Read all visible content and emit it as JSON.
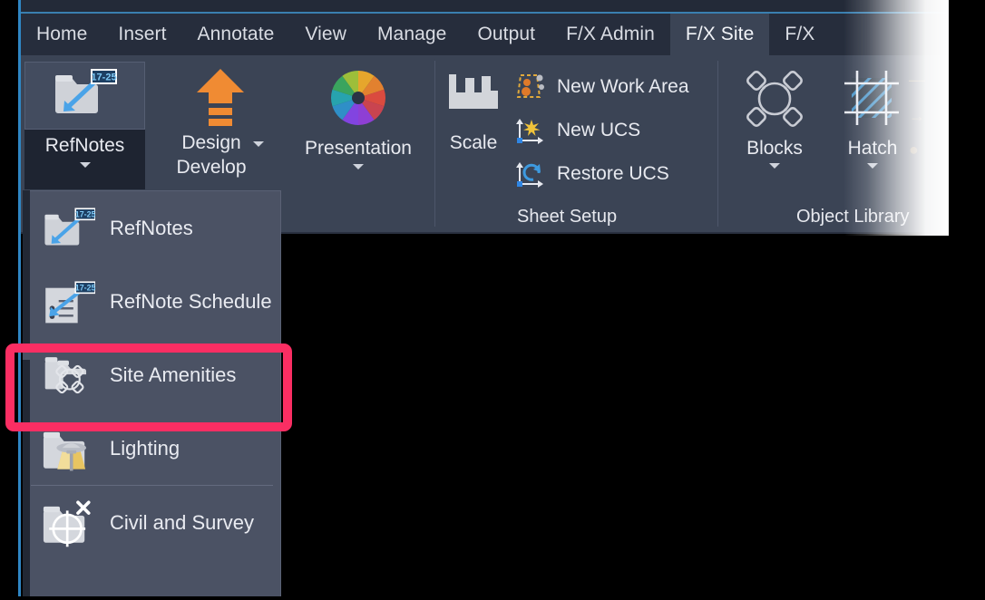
{
  "app": {
    "theme_bg": "#3b4455",
    "tabbar_bg": "#262d3c",
    "menu_bg": "#4b5264",
    "accent_blue": "#2f86c4",
    "highlight_color": "#fa2e63",
    "text_color": "#e8eaf0"
  },
  "ribbon_tabs": [
    {
      "label": "Home",
      "active": false
    },
    {
      "label": "Insert",
      "active": false
    },
    {
      "label": "Annotate",
      "active": false
    },
    {
      "label": "View",
      "active": false
    },
    {
      "label": "Manage",
      "active": false
    },
    {
      "label": "Output",
      "active": false
    },
    {
      "label": "F/X Admin",
      "active": false
    },
    {
      "label": "F/X Site",
      "active": true
    },
    {
      "label": "F/X",
      "active": false
    }
  ],
  "panels": {
    "refnotes": {
      "button_label": "RefNotes",
      "icon": "refnotes-folder-icon",
      "badge": "17-25",
      "has_dropdown": true,
      "state": "active"
    },
    "design_develop": {
      "button_label_line1": "Design",
      "button_label_line2": "Develop",
      "icon": "orange-up-arrow-icon",
      "has_dropdown": true
    },
    "presentation": {
      "button_label": "Presentation",
      "icon": "color-wheel-icon",
      "has_dropdown": true
    },
    "scale": {
      "button_label": "Scale",
      "icon": "scale-bars-icon",
      "has_dropdown": false
    },
    "sheet_setup": {
      "title": "Sheet Setup",
      "items": [
        {
          "label": "New Work Area",
          "icon": "work-area-icon"
        },
        {
          "label": "New UCS",
          "icon": "new-ucs-icon"
        },
        {
          "label": "Restore UCS",
          "icon": "restore-ucs-icon"
        }
      ]
    },
    "object_library": {
      "title": "Object Library",
      "items": [
        {
          "label": "Blocks",
          "icon": "blocks-node-icon",
          "has_dropdown": true
        },
        {
          "label": "Hatch",
          "icon": "hatch-square-icon",
          "has_dropdown": true
        }
      ]
    }
  },
  "refnotes_menu": {
    "items": [
      {
        "label": "RefNotes",
        "icon": "refnotes-folder-icon",
        "badge": "17-25",
        "highlighted": false
      },
      {
        "label": "RefNote Schedule",
        "icon": "refnote-schedule-icon",
        "badge": "17-25",
        "highlighted": false
      },
      {
        "label": "Site  Amenities",
        "icon": "site-amenities-icon",
        "badge": "",
        "highlighted": true
      },
      {
        "label": "Lighting",
        "icon": "lighting-folder-icon",
        "badge": "",
        "highlighted": false
      },
      {
        "label": "Civil and Survey",
        "icon": "civil-survey-icon",
        "badge": "",
        "highlighted": false
      }
    ]
  }
}
